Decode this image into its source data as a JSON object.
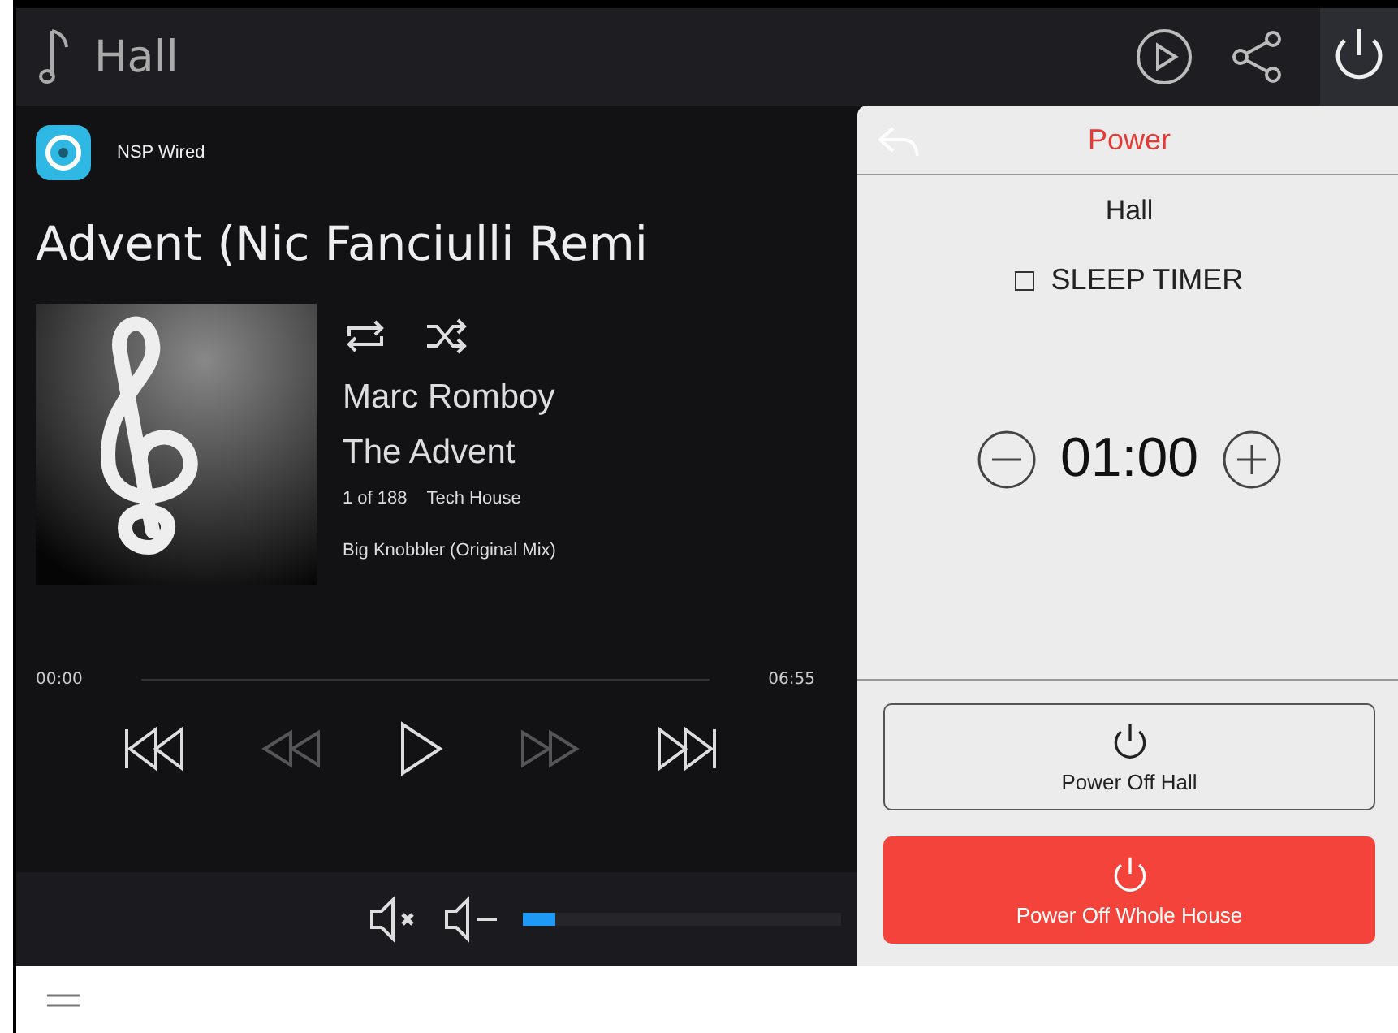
{
  "header": {
    "title": "Hall",
    "power_selected": true
  },
  "source": {
    "name": "NSP Wired"
  },
  "now_playing": {
    "title": "Advent (Nic Fanciulli Remi",
    "artist": "Marc Romboy",
    "album": "The Advent",
    "position": "1 of 188",
    "genre": "Tech House",
    "next_track": "Big Knobbler (Original Mix)"
  },
  "progress": {
    "elapsed": "00:00",
    "duration": "06:55"
  },
  "transport": [
    {
      "kind": "previous",
      "disabled": false
    },
    {
      "kind": "rewind",
      "disabled": true
    },
    {
      "kind": "play",
      "disabled": false
    },
    {
      "kind": "forward",
      "disabled": true
    },
    {
      "kind": "next",
      "disabled": false
    }
  ],
  "volume": {
    "level": 0.1
  },
  "power_panel": {
    "title": "Power",
    "room": "Hall",
    "sleep_timer": {
      "label": "SLEEP TIMER",
      "checked": false
    },
    "timer_value": "01:00",
    "buttons": [
      {
        "label": "Power Off Hall",
        "kind": "outline"
      },
      {
        "label": "Power Off Whole House",
        "kind": "danger"
      }
    ]
  }
}
